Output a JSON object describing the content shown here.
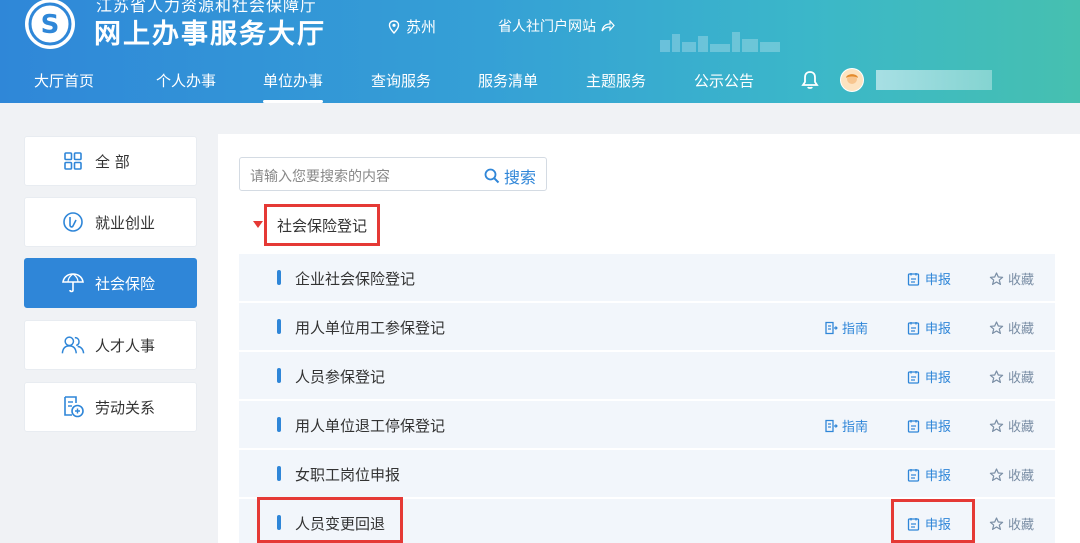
{
  "header": {
    "org_name": "江苏省人力资源和社会保障厅",
    "site_title": "网上办事服务大厅",
    "city": "苏州",
    "portal_link": "省人社门户网站"
  },
  "nav": {
    "items": [
      "大厅首页",
      "个人办事",
      "单位办事",
      "查询服务",
      "服务清单",
      "主题服务",
      "公示公告"
    ],
    "active": "单位办事"
  },
  "sidebar": {
    "items": [
      {
        "label": "全 部",
        "icon": "grid-icon"
      },
      {
        "label": "就业创业",
        "icon": "employment-icon"
      },
      {
        "label": "社会保险",
        "icon": "umbrella-icon",
        "active": true
      },
      {
        "label": "人才人事",
        "icon": "people-icon"
      },
      {
        "label": "劳动关系",
        "icon": "labor-doc-icon"
      }
    ]
  },
  "search": {
    "placeholder": "请输入您要搜索的内容",
    "button_label": "搜索"
  },
  "group": {
    "title": "社会保险登记"
  },
  "actions": {
    "guide": "指南",
    "apply": "申报",
    "favorite": "收藏"
  },
  "services": [
    {
      "name": "企业社会保险登记",
      "has_guide": false
    },
    {
      "name": "用人单位用工参保登记",
      "has_guide": true
    },
    {
      "name": "人员参保登记",
      "has_guide": false
    },
    {
      "name": "用人单位退工停保登记",
      "has_guide": true
    },
    {
      "name": "女职工岗位申报",
      "has_guide": false
    },
    {
      "name": "人员变更回退",
      "has_guide": false
    }
  ],
  "colors": {
    "primary": "#2f86d8",
    "highlight_box": "#e53935",
    "row_bg": "#f2f6fb"
  }
}
